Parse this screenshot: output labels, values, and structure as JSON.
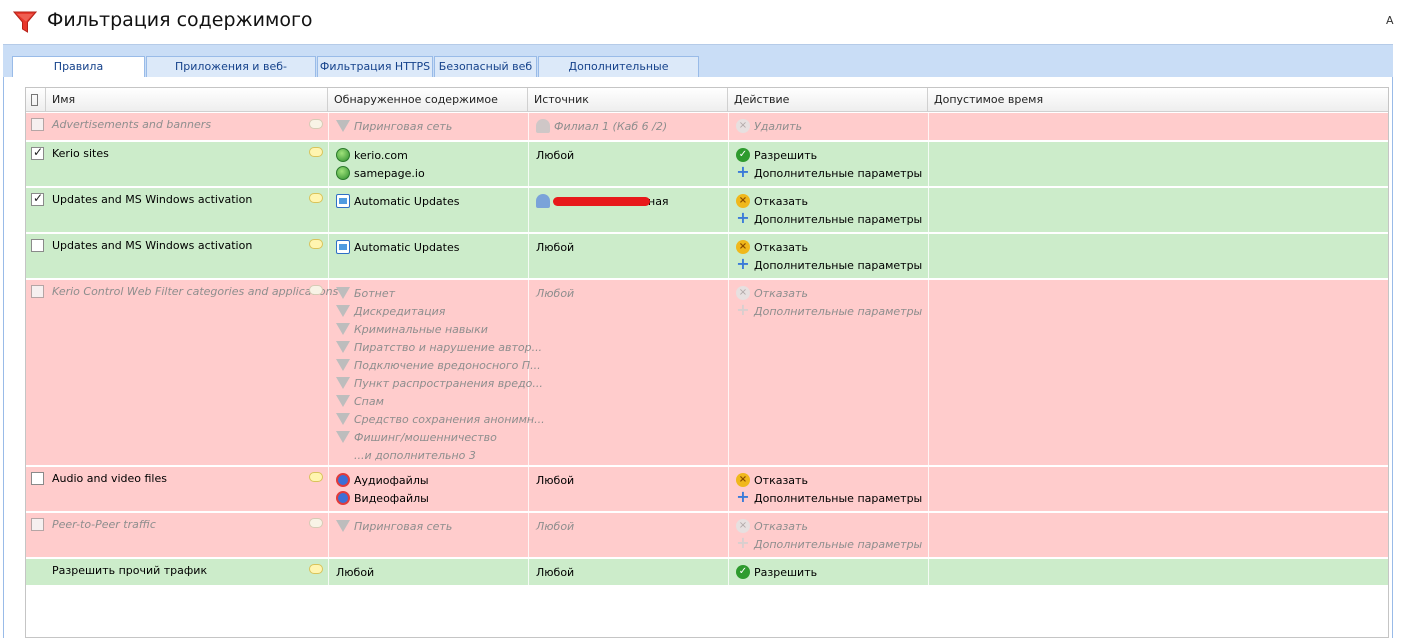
{
  "window": {
    "title": "Фильтрация содержимого",
    "corner_text": "A"
  },
  "tabs": [
    {
      "label": "Правила содержимого",
      "active": true
    },
    {
      "label": "Приложения и веб-категории",
      "active": false
    },
    {
      "label": "Фильтрация HTTPS",
      "active": false
    },
    {
      "label": "Безопасный веб",
      "active": false
    },
    {
      "label": "Дополнительные настройки",
      "active": false
    }
  ],
  "grid": {
    "columns": {
      "name": "Имя",
      "detected": "Обнаруженное содержимое",
      "source": "Источник",
      "action": "Действие",
      "time": "Допустимое время"
    },
    "rows": [
      {
        "name": "Advertisements and banners",
        "enabled": false,
        "detected": [
          "Пиринговая сеть"
        ],
        "source": "Филиал 1 (Каб 6 /2)",
        "action": "Удалить",
        "extra": ""
      },
      {
        "name": "Kerio sites",
        "enabled": true,
        "detected": [
          "kerio.com",
          "samepage.io"
        ],
        "source": "Любой",
        "action": "Разрешить",
        "extra": "Дополнительные параметры"
      },
      {
        "name": "Updates and MS Windows activation",
        "enabled": true,
        "detected": [
          "Automatic Updates"
        ],
        "source": "ная",
        "action": "Отказать",
        "extra": "Дополнительные параметры"
      },
      {
        "name": "Updates and MS Windows activation",
        "enabled": false,
        "detected": [
          "Automatic Updates"
        ],
        "source": "Любой",
        "action": "Отказать",
        "extra": "Дополнительные параметры"
      },
      {
        "name": "Kerio Control Web Filter categories and applications",
        "enabled": false,
        "detected": [
          "Ботнет",
          "Дискредитация",
          "Криминальные навыки",
          "Пиратство и нарушение автор...",
          "Подключение вредоносного П...",
          "Пункт распространения вредо...",
          "Спам",
          "Средство сохранения анонимн...",
          "Фишинг/мошенничество",
          "...и дополнительно 3"
        ],
        "source": "Любой",
        "action": "Отказать",
        "extra": "Дополнительные параметры"
      },
      {
        "name": "Audio and video files",
        "enabled": false,
        "detected": [
          "Аудиофайлы",
          "Видеофайлы"
        ],
        "source": "Любой",
        "action": "Отказать",
        "extra": "Дополнительные параметры"
      },
      {
        "name": "Peer-to-Peer traffic",
        "enabled": false,
        "detected": [
          "Пиринговая сеть"
        ],
        "source": "Любой",
        "action": "Отказать",
        "extra": "Дополнительные параметры"
      },
      {
        "name": "Разрешить прочий трафик",
        "enabled": true,
        "detected": [
          "Любой"
        ],
        "source": "Любой",
        "action": "Разрешить",
        "extra": ""
      }
    ]
  },
  "icons": {
    "title": "funnel-icon",
    "globe": "globe-icon",
    "app": "application-icon",
    "category": "funnel-icon",
    "media": "media-icon",
    "user": "user-icon",
    "allow": "check-icon",
    "deny": "deny-icon",
    "delete": "delete-icon",
    "more": "plus-icon",
    "note": "comment-icon"
  },
  "colors": {
    "disabled_row": "#ffcccc",
    "enabled_row": "#ccecca",
    "tab_strip": "#c9ddf6",
    "title_icon": "#e8382c"
  }
}
